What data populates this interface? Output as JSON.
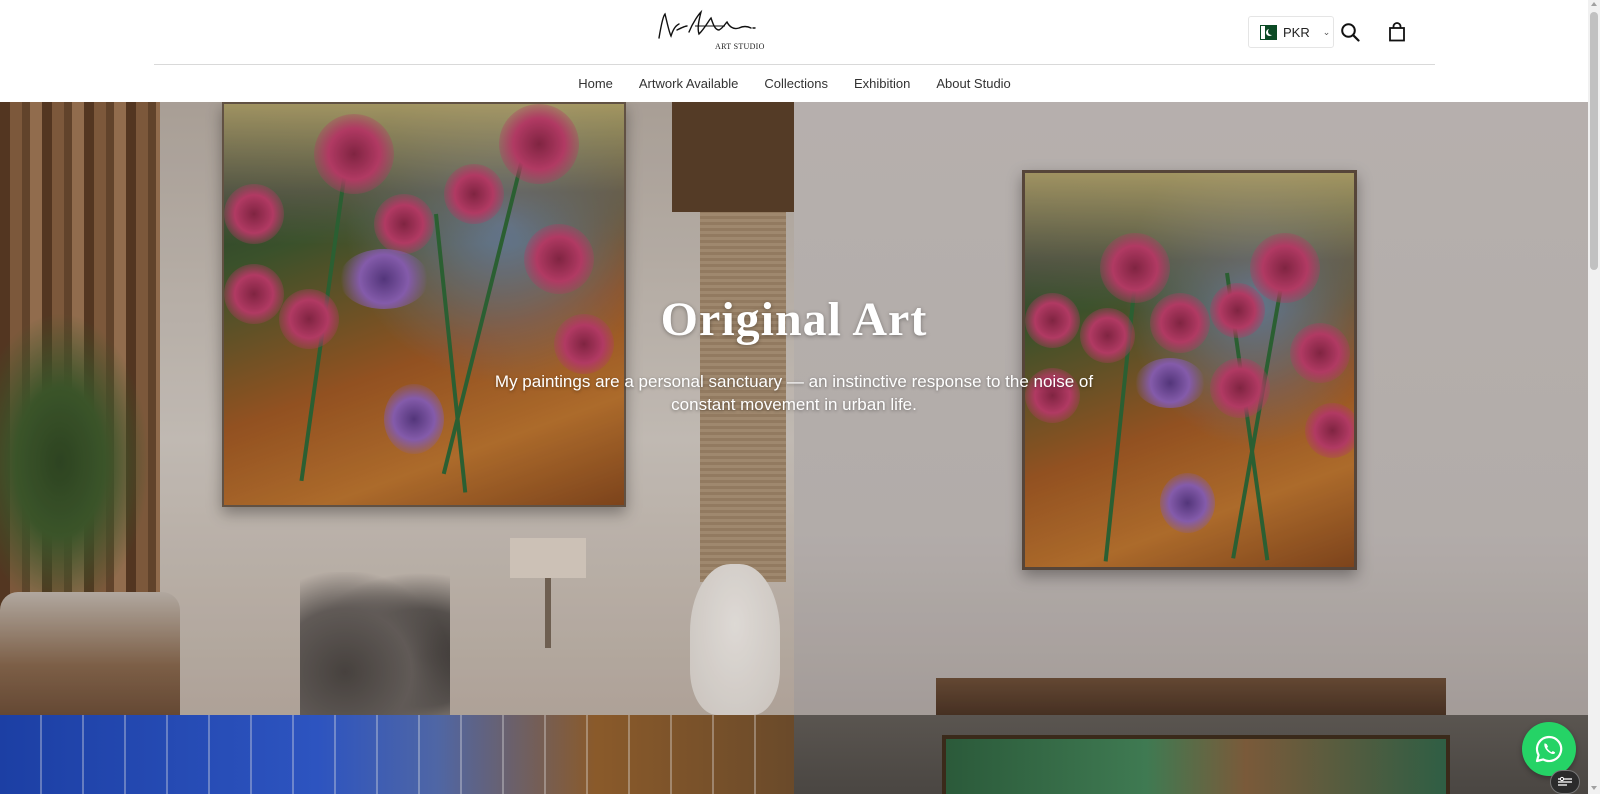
{
  "header": {
    "logo_subtitle": "ART STUDIO",
    "currency": {
      "code": "PKR",
      "flag": "pakistan-flag-icon"
    },
    "icons": [
      "search-icon",
      "shopping-bag-icon"
    ]
  },
  "nav": {
    "items": [
      {
        "label": "Home"
      },
      {
        "label": "Artwork Available"
      },
      {
        "label": "Collections"
      },
      {
        "label": "Exhibition"
      },
      {
        "label": "About Studio"
      }
    ]
  },
  "hero": {
    "title": "Original Art",
    "text": "My paintings are a personal sanctuary — an instinctive response to the noise of constant movement in urban life."
  },
  "floating": {
    "whatsapp_icon": "whatsapp-icon",
    "widget_icon": "settings-sliders-icon"
  },
  "colors": {
    "whatsapp": "#25d366",
    "nav_text": "#333333",
    "hero_text": "#ffffff"
  }
}
